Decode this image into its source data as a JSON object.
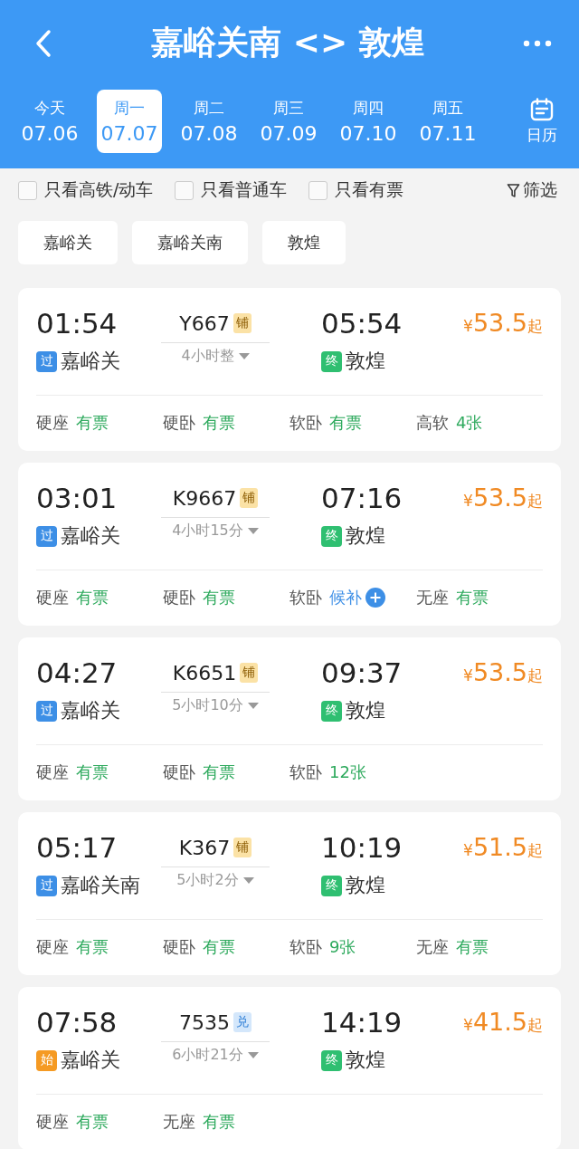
{
  "header": {
    "title": "嘉峪关南 <> 敦煌",
    "calendar_label": "日历"
  },
  "dates": [
    {
      "weekday": "今天",
      "date": "07.06",
      "selected": false
    },
    {
      "weekday": "周一",
      "date": "07.07",
      "selected": true
    },
    {
      "weekday": "周二",
      "date": "07.08",
      "selected": false
    },
    {
      "weekday": "周三",
      "date": "07.09",
      "selected": false
    },
    {
      "weekday": "周四",
      "date": "07.10",
      "selected": false
    },
    {
      "weekday": "周五",
      "date": "07.11",
      "selected": false
    }
  ],
  "filters": [
    {
      "label": "只看高铁/动车",
      "checked": false
    },
    {
      "label": "只看普通车",
      "checked": false
    },
    {
      "label": "只看有票",
      "checked": false
    }
  ],
  "filter_button": "筛选",
  "stations": [
    "嘉峪关",
    "嘉峪关南",
    "敦煌"
  ],
  "trains": [
    {
      "depart": "01:54",
      "number": "Y667",
      "badge": {
        "kind": "berth",
        "text": "铺"
      },
      "duration": "4小时整",
      "arrive": "05:54",
      "from": {
        "kind": "pass",
        "tag": "过",
        "name": "嘉峪关"
      },
      "to": {
        "kind": "end",
        "tag": "终",
        "name": "敦煌"
      },
      "price": "53.5",
      "currency": "¥",
      "suffix": "起",
      "seats": [
        {
          "type": "硬座",
          "status": "有票",
          "kind": "available"
        },
        {
          "type": "硬卧",
          "status": "有票",
          "kind": "available"
        },
        {
          "type": "软卧",
          "status": "有票",
          "kind": "available"
        },
        {
          "type": "高软",
          "status": "4张",
          "kind": "available"
        }
      ]
    },
    {
      "depart": "03:01",
      "number": "K9667",
      "badge": {
        "kind": "berth",
        "text": "铺"
      },
      "duration": "4小时15分",
      "arrive": "07:16",
      "from": {
        "kind": "pass",
        "tag": "过",
        "name": "嘉峪关"
      },
      "to": {
        "kind": "end",
        "tag": "终",
        "name": "敦煌"
      },
      "price": "53.5",
      "currency": "¥",
      "suffix": "起",
      "seats": [
        {
          "type": "硬座",
          "status": "有票",
          "kind": "available"
        },
        {
          "type": "硬卧",
          "status": "有票",
          "kind": "available"
        },
        {
          "type": "软卧",
          "status": "候补",
          "kind": "waitlist"
        },
        {
          "type": "无座",
          "status": "有票",
          "kind": "available"
        }
      ]
    },
    {
      "depart": "04:27",
      "number": "K6651",
      "badge": {
        "kind": "berth",
        "text": "铺"
      },
      "duration": "5小时10分",
      "arrive": "09:37",
      "from": {
        "kind": "pass",
        "tag": "过",
        "name": "嘉峪关"
      },
      "to": {
        "kind": "end",
        "tag": "终",
        "name": "敦煌"
      },
      "price": "53.5",
      "currency": "¥",
      "suffix": "起",
      "seats": [
        {
          "type": "硬座",
          "status": "有票",
          "kind": "available"
        },
        {
          "type": "硬卧",
          "status": "有票",
          "kind": "available"
        },
        {
          "type": "软卧",
          "status": "12张",
          "kind": "available"
        }
      ]
    },
    {
      "depart": "05:17",
      "number": "K367",
      "badge": {
        "kind": "berth",
        "text": "铺"
      },
      "duration": "5小时2分",
      "arrive": "10:19",
      "from": {
        "kind": "pass",
        "tag": "过",
        "name": "嘉峪关南"
      },
      "to": {
        "kind": "end",
        "tag": "终",
        "name": "敦煌"
      },
      "price": "51.5",
      "currency": "¥",
      "suffix": "起",
      "seats": [
        {
          "type": "硬座",
          "status": "有票",
          "kind": "available"
        },
        {
          "type": "硬卧",
          "status": "有票",
          "kind": "available"
        },
        {
          "type": "软卧",
          "status": "9张",
          "kind": "available"
        },
        {
          "type": "无座",
          "status": "有票",
          "kind": "available"
        }
      ]
    },
    {
      "depart": "07:58",
      "number": "7535",
      "badge": {
        "kind": "redeem",
        "text": "兑"
      },
      "duration": "6小时21分",
      "arrive": "14:19",
      "from": {
        "kind": "start",
        "tag": "始",
        "name": "嘉峪关"
      },
      "to": {
        "kind": "end",
        "tag": "终",
        "name": "敦煌"
      },
      "price": "41.5",
      "currency": "¥",
      "suffix": "起",
      "seats": [
        {
          "type": "硬座",
          "status": "有票",
          "kind": "available"
        },
        {
          "type": "无座",
          "status": "有票",
          "kind": "available"
        }
      ]
    }
  ]
}
